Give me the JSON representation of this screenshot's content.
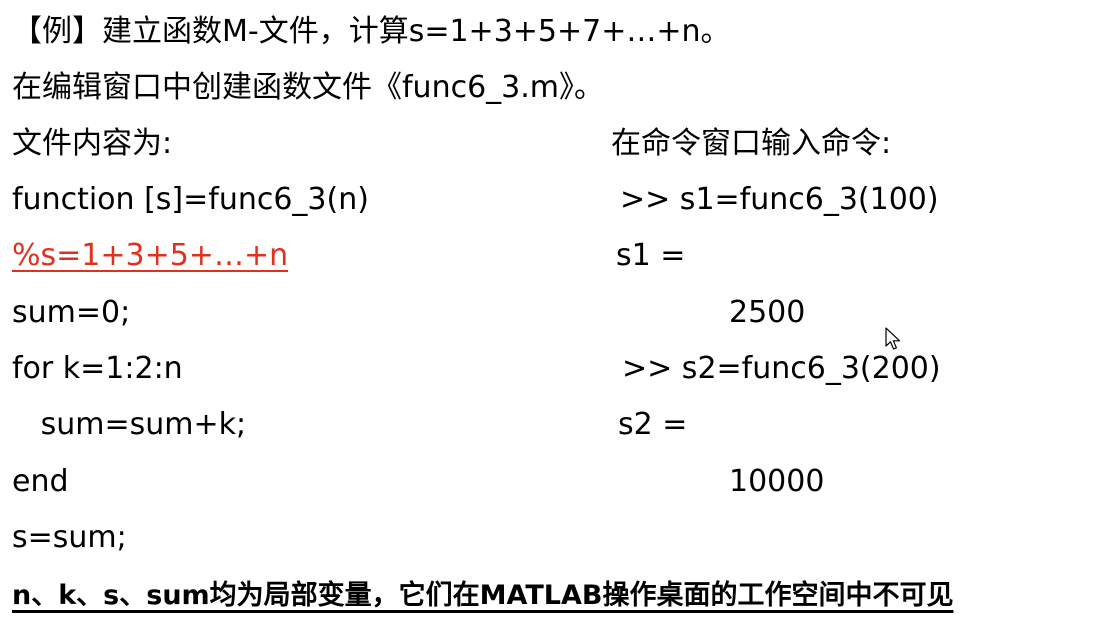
{
  "heading": {
    "example_line": "【例】建立函数M-文件，计算s=1+3+5+7+…+n。",
    "create_line": "在编辑窗口中创建函数文件《func6_3.m》。"
  },
  "left_column": {
    "title": "文件内容为:",
    "code": [
      "function [s]=func6_3(n)",
      "%s=1+3+5+…+n",
      "sum=0;",
      "for k=1:2:n",
      "   sum=sum+k;",
      "end",
      "s=sum;"
    ]
  },
  "right_column": {
    "title": "在命令窗口输入命令:",
    "lines": [
      ">> s1=func6_3(100)",
      "s1 =",
      "2500",
      ">> s2=func6_3(200)",
      "s2 =",
      "10000"
    ]
  },
  "footer": {
    "note": "n、k、s、sum均为局部变量，它们在MATLAB操作桌面的工作空间中不可见"
  },
  "colors": {
    "comment": "#e0301e",
    "text": "#000000"
  },
  "icons": {
    "cursor": "mouse-pointer-icon"
  }
}
